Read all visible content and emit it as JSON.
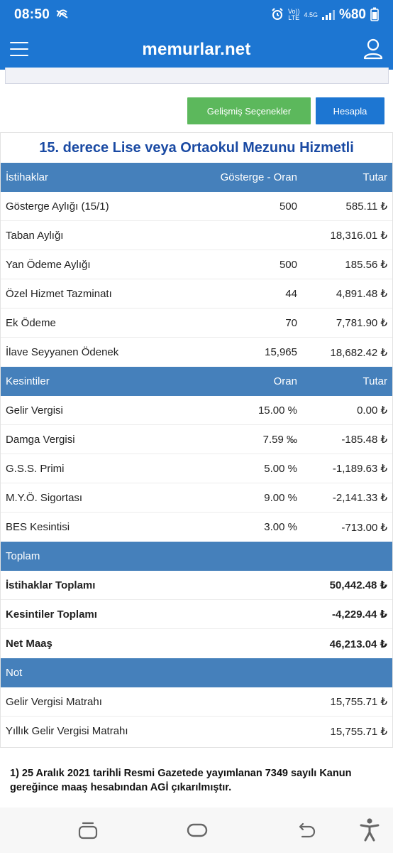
{
  "status": {
    "time": "08:50",
    "net_top": "Vo))",
    "net_bottom": "LTE",
    "net_gen": "4.5G",
    "battery": "%80"
  },
  "app": {
    "brand": "memurlar.net"
  },
  "buttons": {
    "advanced": "Gelişmiş Seçenekler",
    "calculate": "Hesapla"
  },
  "title": "15. derece Lise veya Ortaokul Mezunu Hizmetli",
  "entitlements": {
    "headers": [
      "İstihaklar",
      "Gösterge - Oran",
      "Tutar"
    ],
    "rows": [
      [
        "Gösterge Aylığı (15/1)",
        "500",
        "585.11 ₺"
      ],
      [
        "Taban Aylığı",
        "",
        "18,316.01 ₺"
      ],
      [
        "Yan Ödeme Aylığı",
        "500",
        "185.56 ₺"
      ],
      [
        "Özel Hizmet Tazminatı",
        "44",
        "4,891.48 ₺"
      ],
      [
        "Ek Ödeme",
        "70",
        "7,781.90 ₺"
      ],
      [
        "İlave Seyyanen Ödenek",
        "15,965",
        "18,682.42 ₺"
      ]
    ]
  },
  "deductions": {
    "headers": [
      "Kesintiler",
      "Oran",
      "Tutar"
    ],
    "rows": [
      [
        "Gelir Vergisi",
        "15.00 %",
        "0.00 ₺"
      ],
      [
        "Damga Vergisi",
        "7.59 ‰",
        "-185.48 ₺"
      ],
      [
        "G.S.S. Primi",
        "5.00 %",
        "-1,189.63 ₺"
      ],
      [
        "M.Y.Ö. Sigortası",
        "9.00 %",
        "-2,141.33 ₺"
      ],
      [
        "BES Kesintisi",
        "3.00 %",
        "-713.00 ₺"
      ]
    ]
  },
  "totals": {
    "header": "Toplam",
    "rows": [
      [
        "İstihaklar Toplamı",
        "50,442.48 ₺"
      ],
      [
        "Kesintiler Toplamı",
        "-4,229.44 ₺"
      ],
      [
        "Net Maaş",
        "46,213.04 ₺"
      ]
    ]
  },
  "notes": {
    "header": "Not",
    "rows": [
      [
        "Gelir Vergisi Matrahı",
        "15,755.71 ₺"
      ],
      [
        "Yıllık Gelir Vergisi Matrahı",
        "15,755.71 ₺"
      ]
    ]
  },
  "footnote": "1) 25 Aralık 2021 tarihli Resmi Gazetede yayımlanan 7349 sayılı Kanun gereğince maaş hesabından AGİ çıkarılmıştır.",
  "icons": {
    "menu": "hamburger-menu-icon",
    "user": "user-icon",
    "nav_recent": "recent-apps-icon",
    "nav_home": "home-icon",
    "nav_back": "back-icon",
    "nav_access": "accessibility-icon"
  }
}
